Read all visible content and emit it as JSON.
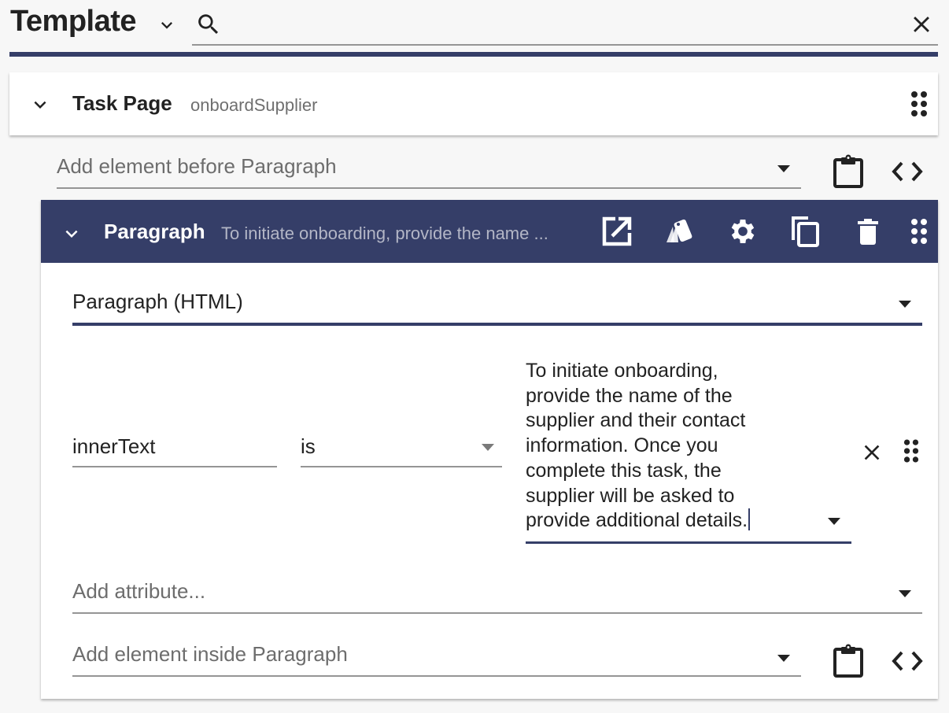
{
  "header": {
    "title": "Template",
    "search_placeholder": "",
    "search_value": ""
  },
  "task_page": {
    "title": "Task Page",
    "subtitle": "onboardSupplier"
  },
  "add_before": {
    "placeholder": "Add element before Paragraph"
  },
  "paragraph": {
    "title": "Paragraph",
    "subtitle": "To initiate onboarding, provide the name ...",
    "type_select": "Paragraph (HTML)",
    "attribute": {
      "name": "innerText",
      "operator": "is",
      "value": "To initiate onboarding,\nprovide the name of the\nsupplier and their contact\ninformation. Once you\ncomplete this task, the\nsupplier will be asked to\nprovide additional details."
    },
    "add_attribute_placeholder": "Add attribute...",
    "add_inside_placeholder": "Add element inside Paragraph"
  },
  "icons": {
    "header": [
      "chevron-down-icon",
      "search-icon",
      "close-icon"
    ],
    "task_page": [
      "chevron-down-icon",
      "drag-handle-icon"
    ],
    "add_row": [
      "dropdown-arrow-icon",
      "clipboard-icon",
      "code-icon"
    ],
    "paragraph_toolbar": [
      "open-in-new-icon",
      "style-icon",
      "settings-icon",
      "copy-icon",
      "delete-icon",
      "drag-handle-icon"
    ]
  },
  "colors": {
    "accent": "#353e68",
    "background": "#f7f7f7",
    "card": "#ffffff",
    "muted_text": "#6d6d6d",
    "underline": "#959595"
  }
}
